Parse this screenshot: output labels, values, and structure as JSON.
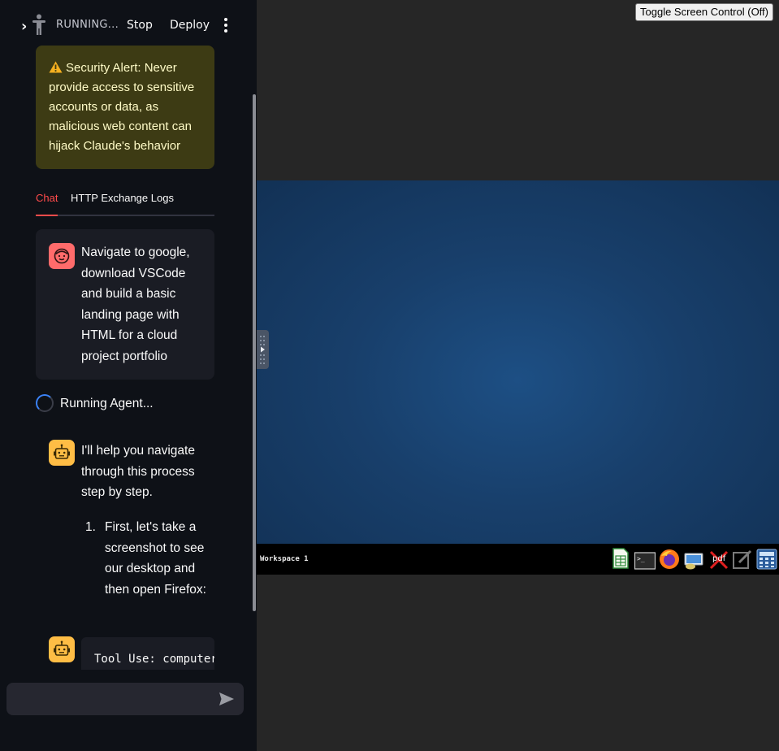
{
  "header": {
    "running_label": "RUNNING...",
    "stop_label": "Stop",
    "deploy_label": "Deploy"
  },
  "alert": {
    "text": "Security Alert: Never provide access to sensitive accounts or data, as malicious web content can hijack Claude's behavior"
  },
  "tabs": [
    {
      "label": "Chat",
      "active": true
    },
    {
      "label": "HTTP Exchange Logs",
      "active": false
    }
  ],
  "messages": {
    "user_text": "Navigate to google, download VSCode and build a basic landing page with HTML for a cloud project portfolio",
    "status": "Running Agent...",
    "assistant_intro": "I'll help you navigate through this process step by step.",
    "assistant_step_number": "1.",
    "assistant_step_text": "First, let's take a screenshot to see our desktop and then open Firefox:",
    "tool_use": "Tool Use: computer"
  },
  "chat_input": {
    "value": "",
    "placeholder": ""
  },
  "main": {
    "toggle_label": "Toggle Screen Control (Off)",
    "workspace_label": "Workspace 1",
    "tray_pdf_label": "pdf",
    "tray_icons": [
      "spreadsheet-icon",
      "terminal-icon",
      "firefox-icon",
      "image-viewer-icon",
      "pdf-viewer-icon",
      "text-editor-icon",
      "calculator-icon"
    ]
  },
  "colors": {
    "sidebar_bg": "#0e1117",
    "accent_red": "#ff4b4b",
    "alert_bg": "#3d3b14",
    "alert_text": "#fffbc7",
    "user_avatar": "#ff6b6b",
    "bot_avatar": "#ffbd45",
    "desktop_blue": "#1d4f84"
  }
}
